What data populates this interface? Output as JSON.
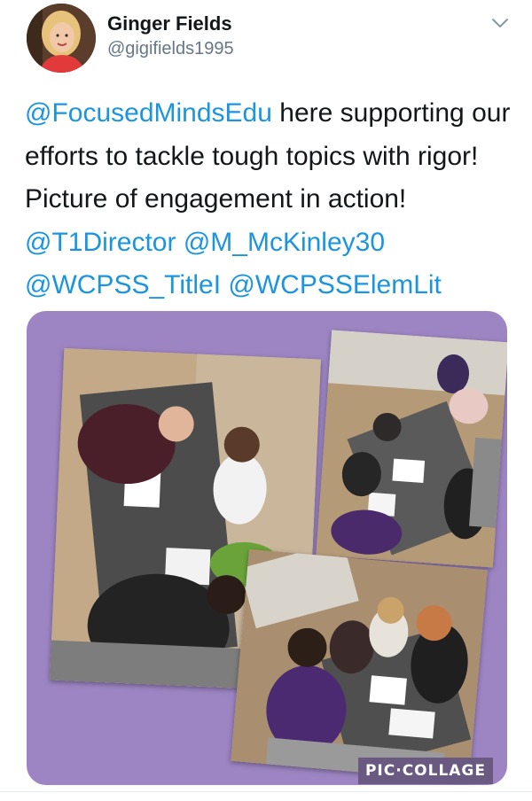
{
  "tweet": {
    "author_name": "Ginger Fields",
    "author_handle": "@gigifields1995",
    "text_segments": [
      {
        "text": "@FocusedMindsEdu",
        "type": "mention"
      },
      {
        "text": " here supporting our efforts to tackle tough topics with rigor! Picture of engagement in action! ",
        "type": "text"
      },
      {
        "text": "@T1Director",
        "type": "mention"
      },
      {
        "text": " ",
        "type": "text"
      },
      {
        "text": "@M_McKinley30",
        "type": "mention"
      },
      {
        "text": " ",
        "type": "text"
      },
      {
        "text": "@WCPSS_TitleI",
        "type": "mention"
      },
      {
        "text": " ",
        "type": "text"
      },
      {
        "text": "@WCPSSElemLit",
        "type": "mention"
      }
    ]
  },
  "media": {
    "watermark": "PIC·COLLAGE",
    "background_color": "#9d85c3"
  },
  "icons": {
    "menu": "chevron-down-icon"
  },
  "colors": {
    "mention": "#1b95e0",
    "text": "#14171a",
    "secondary": "#657786"
  }
}
